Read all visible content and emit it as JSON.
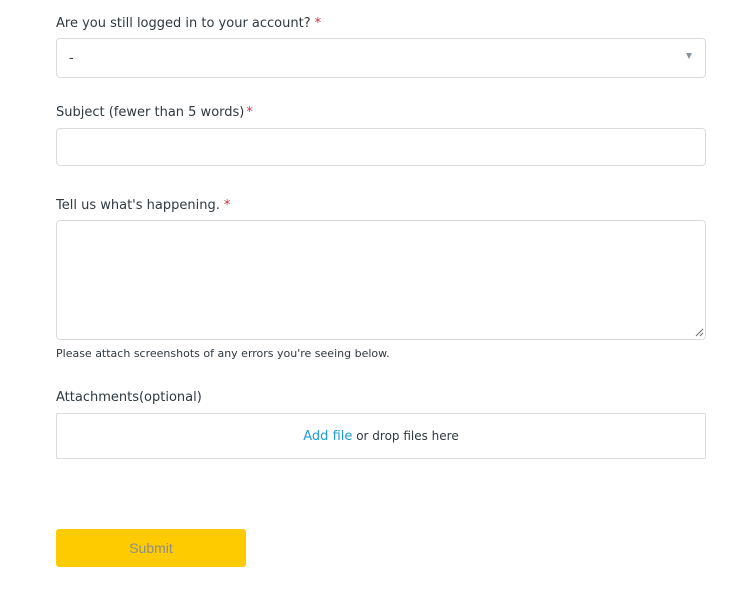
{
  "form": {
    "logged_in": {
      "label": "Are you still logged in to your account?",
      "required_mark": "*",
      "selected_value": "-"
    },
    "subject": {
      "label": "Subject (fewer than 5 words)",
      "required_mark": "*",
      "value": ""
    },
    "description": {
      "label": "Tell us what's happening.",
      "required_mark": "*",
      "value": "",
      "hint": "Please attach screenshots of any errors you're seeing below."
    },
    "attachments": {
      "label": "Attachments(optional)",
      "add_file_link": "Add file",
      "drop_text": " or drop files here"
    },
    "submit_label": "Submit"
  },
  "colors": {
    "required": "#cc3340",
    "link": "#1f9bd7",
    "submit_bg": "#fecb00",
    "submit_text": "#8c8c8c",
    "border": "#d8dcde"
  },
  "icons": {
    "select_chevron": "chevron-down-icon",
    "textarea_resize": "resize-handle-icon"
  }
}
